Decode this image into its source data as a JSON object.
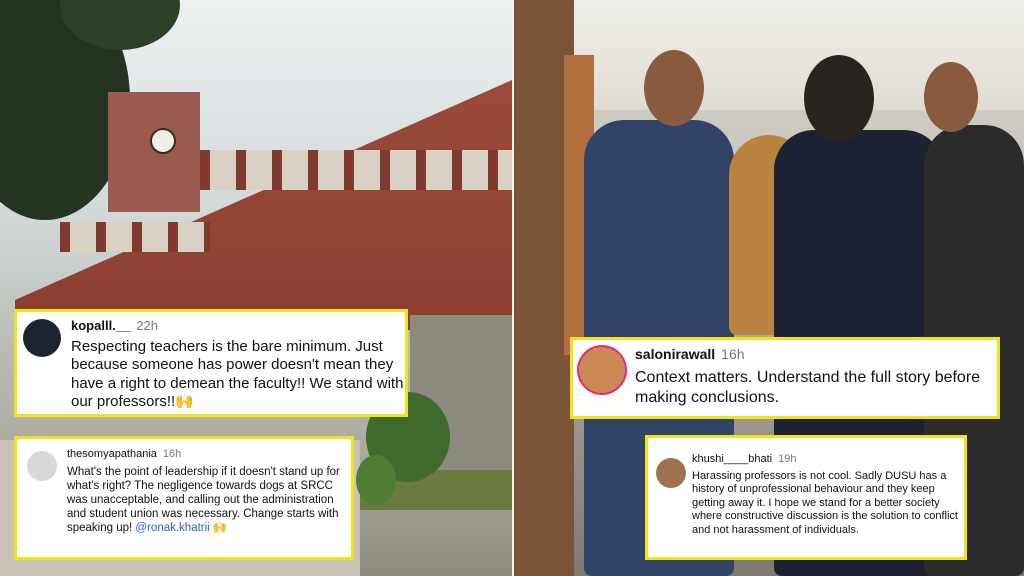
{
  "comments": [
    {
      "username": "kopalll.__",
      "time": "22h",
      "text": "Respecting teachers is the bare minimum. Just because someone has power doesn't mean they have a right to demean the faculty!! We stand with our professors!!🙌"
    },
    {
      "username": "thesomyapathania",
      "time": "16h",
      "text_before_mention": "What's the point of leadership if it doesn't stand up for what's right? The negligence towards dogs at SRCC was unacceptable, and calling out the administration and student union was necessary. Change starts with speaking up! ",
      "mention": "@ronak.khatrii",
      "text_after_mention": " 🙌"
    },
    {
      "username": "salonirawall",
      "time": "16h",
      "text": "Context matters. Understand the full story before making conclusions."
    },
    {
      "username": "khushi____bhati",
      "time": "19h",
      "text": "Harassing professors is not cool. Sadly DUSU has a history of unprofessional behaviour and they keep getting away it. I hope we stand for a better society where constructive discussion is the solution to conflict and not harassment of individuals."
    }
  ],
  "colors": {
    "card_border": "#f1e21a",
    "mention": "#2a62c9",
    "story_ring": "#e6297a"
  }
}
